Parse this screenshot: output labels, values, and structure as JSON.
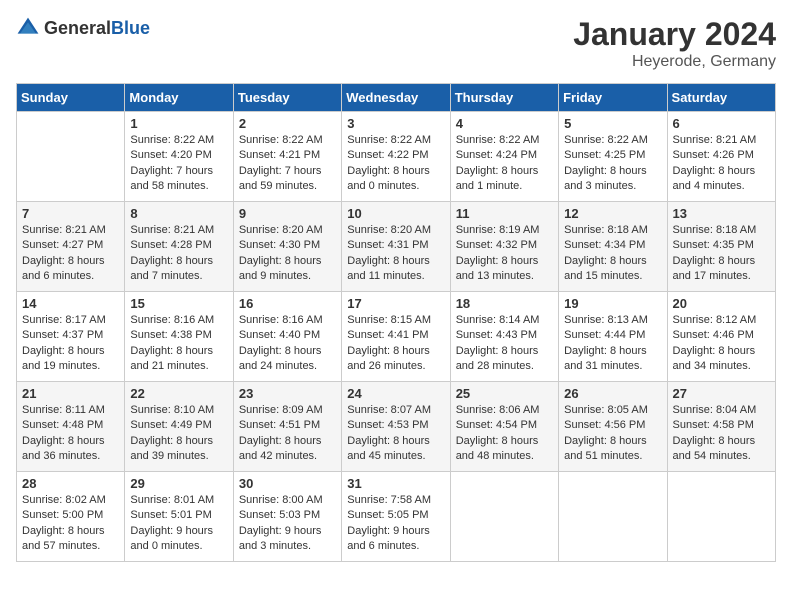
{
  "header": {
    "logo_general": "General",
    "logo_blue": "Blue",
    "month": "January 2024",
    "location": "Heyerode, Germany"
  },
  "weekdays": [
    "Sunday",
    "Monday",
    "Tuesday",
    "Wednesday",
    "Thursday",
    "Friday",
    "Saturday"
  ],
  "weeks": [
    [
      {
        "day": "",
        "sunrise": "",
        "sunset": "",
        "daylight": ""
      },
      {
        "day": "1",
        "sunrise": "Sunrise: 8:22 AM",
        "sunset": "Sunset: 4:20 PM",
        "daylight": "Daylight: 7 hours and 58 minutes."
      },
      {
        "day": "2",
        "sunrise": "Sunrise: 8:22 AM",
        "sunset": "Sunset: 4:21 PM",
        "daylight": "Daylight: 7 hours and 59 minutes."
      },
      {
        "day": "3",
        "sunrise": "Sunrise: 8:22 AM",
        "sunset": "Sunset: 4:22 PM",
        "daylight": "Daylight: 8 hours and 0 minutes."
      },
      {
        "day": "4",
        "sunrise": "Sunrise: 8:22 AM",
        "sunset": "Sunset: 4:24 PM",
        "daylight": "Daylight: 8 hours and 1 minute."
      },
      {
        "day": "5",
        "sunrise": "Sunrise: 8:22 AM",
        "sunset": "Sunset: 4:25 PM",
        "daylight": "Daylight: 8 hours and 3 minutes."
      },
      {
        "day": "6",
        "sunrise": "Sunrise: 8:21 AM",
        "sunset": "Sunset: 4:26 PM",
        "daylight": "Daylight: 8 hours and 4 minutes."
      }
    ],
    [
      {
        "day": "7",
        "sunrise": "Sunrise: 8:21 AM",
        "sunset": "Sunset: 4:27 PM",
        "daylight": "Daylight: 8 hours and 6 minutes."
      },
      {
        "day": "8",
        "sunrise": "Sunrise: 8:21 AM",
        "sunset": "Sunset: 4:28 PM",
        "daylight": "Daylight: 8 hours and 7 minutes."
      },
      {
        "day": "9",
        "sunrise": "Sunrise: 8:20 AM",
        "sunset": "Sunset: 4:30 PM",
        "daylight": "Daylight: 8 hours and 9 minutes."
      },
      {
        "day": "10",
        "sunrise": "Sunrise: 8:20 AM",
        "sunset": "Sunset: 4:31 PM",
        "daylight": "Daylight: 8 hours and 11 minutes."
      },
      {
        "day": "11",
        "sunrise": "Sunrise: 8:19 AM",
        "sunset": "Sunset: 4:32 PM",
        "daylight": "Daylight: 8 hours and 13 minutes."
      },
      {
        "day": "12",
        "sunrise": "Sunrise: 8:18 AM",
        "sunset": "Sunset: 4:34 PM",
        "daylight": "Daylight: 8 hours and 15 minutes."
      },
      {
        "day": "13",
        "sunrise": "Sunrise: 8:18 AM",
        "sunset": "Sunset: 4:35 PM",
        "daylight": "Daylight: 8 hours and 17 minutes."
      }
    ],
    [
      {
        "day": "14",
        "sunrise": "Sunrise: 8:17 AM",
        "sunset": "Sunset: 4:37 PM",
        "daylight": "Daylight: 8 hours and 19 minutes."
      },
      {
        "day": "15",
        "sunrise": "Sunrise: 8:16 AM",
        "sunset": "Sunset: 4:38 PM",
        "daylight": "Daylight: 8 hours and 21 minutes."
      },
      {
        "day": "16",
        "sunrise": "Sunrise: 8:16 AM",
        "sunset": "Sunset: 4:40 PM",
        "daylight": "Daylight: 8 hours and 24 minutes."
      },
      {
        "day": "17",
        "sunrise": "Sunrise: 8:15 AM",
        "sunset": "Sunset: 4:41 PM",
        "daylight": "Daylight: 8 hours and 26 minutes."
      },
      {
        "day": "18",
        "sunrise": "Sunrise: 8:14 AM",
        "sunset": "Sunset: 4:43 PM",
        "daylight": "Daylight: 8 hours and 28 minutes."
      },
      {
        "day": "19",
        "sunrise": "Sunrise: 8:13 AM",
        "sunset": "Sunset: 4:44 PM",
        "daylight": "Daylight: 8 hours and 31 minutes."
      },
      {
        "day": "20",
        "sunrise": "Sunrise: 8:12 AM",
        "sunset": "Sunset: 4:46 PM",
        "daylight": "Daylight: 8 hours and 34 minutes."
      }
    ],
    [
      {
        "day": "21",
        "sunrise": "Sunrise: 8:11 AM",
        "sunset": "Sunset: 4:48 PM",
        "daylight": "Daylight: 8 hours and 36 minutes."
      },
      {
        "day": "22",
        "sunrise": "Sunrise: 8:10 AM",
        "sunset": "Sunset: 4:49 PM",
        "daylight": "Daylight: 8 hours and 39 minutes."
      },
      {
        "day": "23",
        "sunrise": "Sunrise: 8:09 AM",
        "sunset": "Sunset: 4:51 PM",
        "daylight": "Daylight: 8 hours and 42 minutes."
      },
      {
        "day": "24",
        "sunrise": "Sunrise: 8:07 AM",
        "sunset": "Sunset: 4:53 PM",
        "daylight": "Daylight: 8 hours and 45 minutes."
      },
      {
        "day": "25",
        "sunrise": "Sunrise: 8:06 AM",
        "sunset": "Sunset: 4:54 PM",
        "daylight": "Daylight: 8 hours and 48 minutes."
      },
      {
        "day": "26",
        "sunrise": "Sunrise: 8:05 AM",
        "sunset": "Sunset: 4:56 PM",
        "daylight": "Daylight: 8 hours and 51 minutes."
      },
      {
        "day": "27",
        "sunrise": "Sunrise: 8:04 AM",
        "sunset": "Sunset: 4:58 PM",
        "daylight": "Daylight: 8 hours and 54 minutes."
      }
    ],
    [
      {
        "day": "28",
        "sunrise": "Sunrise: 8:02 AM",
        "sunset": "Sunset: 5:00 PM",
        "daylight": "Daylight: 8 hours and 57 minutes."
      },
      {
        "day": "29",
        "sunrise": "Sunrise: 8:01 AM",
        "sunset": "Sunset: 5:01 PM",
        "daylight": "Daylight: 9 hours and 0 minutes."
      },
      {
        "day": "30",
        "sunrise": "Sunrise: 8:00 AM",
        "sunset": "Sunset: 5:03 PM",
        "daylight": "Daylight: 9 hours and 3 minutes."
      },
      {
        "day": "31",
        "sunrise": "Sunrise: 7:58 AM",
        "sunset": "Sunset: 5:05 PM",
        "daylight": "Daylight: 9 hours and 6 minutes."
      },
      {
        "day": "",
        "sunrise": "",
        "sunset": "",
        "daylight": ""
      },
      {
        "day": "",
        "sunrise": "",
        "sunset": "",
        "daylight": ""
      },
      {
        "day": "",
        "sunrise": "",
        "sunset": "",
        "daylight": ""
      }
    ]
  ]
}
